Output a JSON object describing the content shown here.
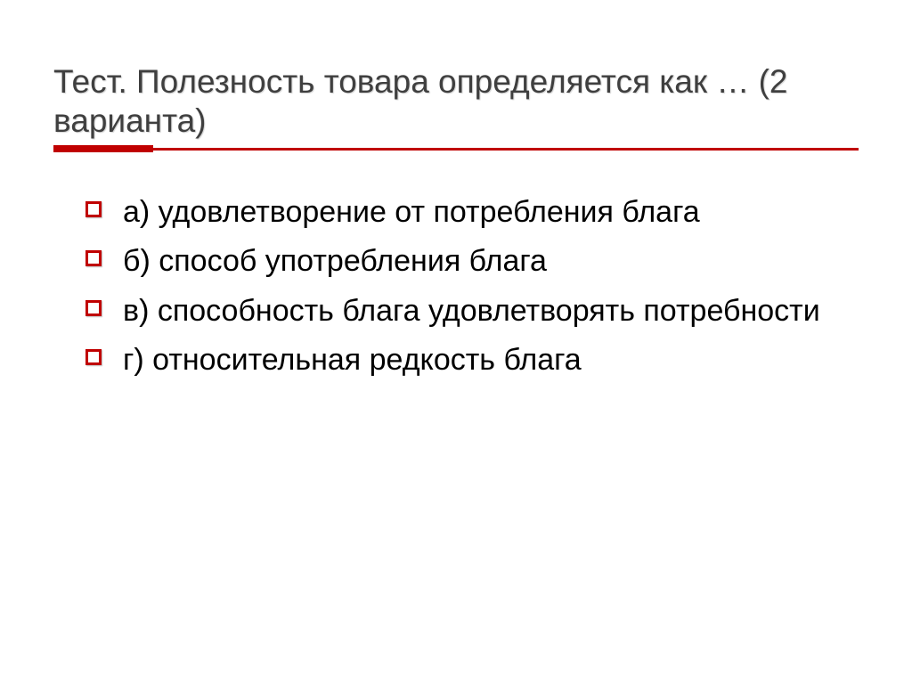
{
  "title": "Тест. Полезность товара определяется как … (2 варианта)",
  "items": [
    {
      "label": "а) удовлетворение от потребления блага"
    },
    {
      "label": "б) способ употребления блага"
    },
    {
      "label": "в) способность блага удовлетворять потребности"
    },
    {
      "label": "г) относительная редкость блага"
    }
  ]
}
